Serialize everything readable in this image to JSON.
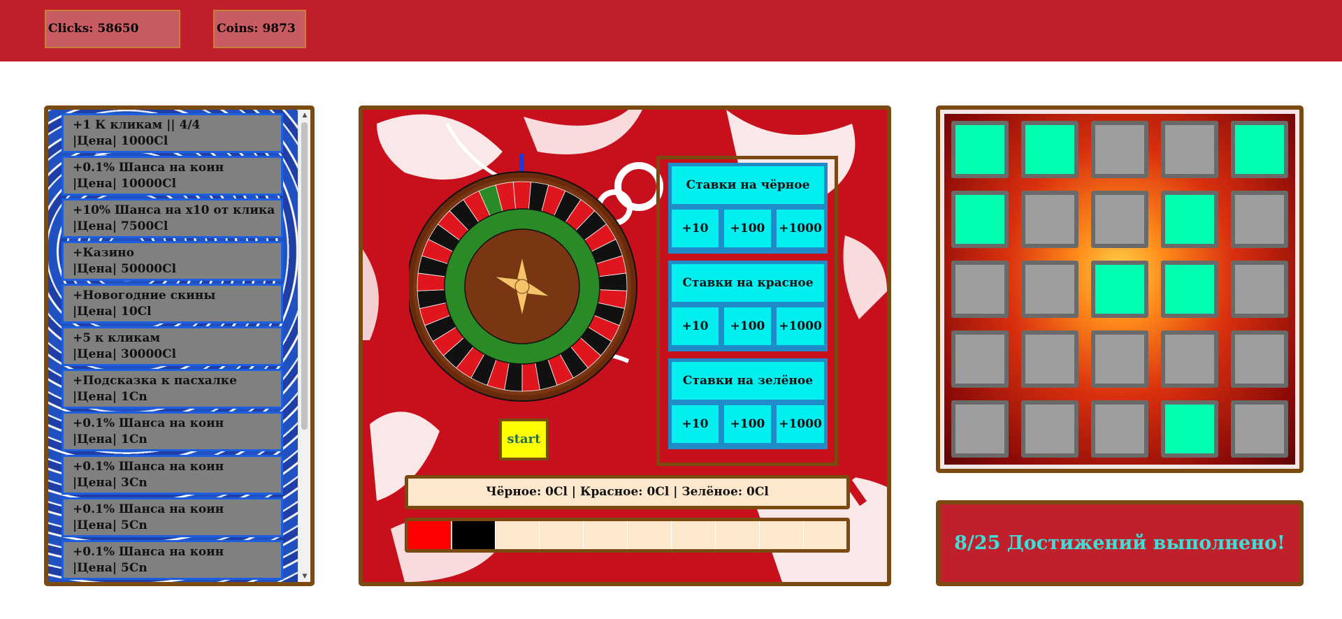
{
  "header": {
    "clicks_text": "Clicks: 58650",
    "coins_text": "Coins: 9873"
  },
  "shop": {
    "items": [
      {
        "line1": "+1 К кликам || 4/4",
        "line2": "|Цена| 1000Cl"
      },
      {
        "line1": "+0.1% Шанса на коин",
        "line2": "|Цена| 10000Cl"
      },
      {
        "line1": "+10% Шанса на x10 от клика",
        "line2": "|Цена| 7500Cl"
      },
      {
        "line1": "+Казино",
        "line2": "|Цена| 50000Cl"
      },
      {
        "line1": "+Новогодние скины",
        "line2": "|Цена| 10Cl"
      },
      {
        "line1": "+5 к кликам",
        "line2": "|Цена| 30000Cl"
      },
      {
        "line1": "+Подсказка к пасхалке",
        "line2": "|Цена| 1Cn"
      },
      {
        "line1": "+0.1% Шанса на коин",
        "line2": "|Цена| 1Cn"
      },
      {
        "line1": "+0.1% Шанса на коин",
        "line2": "|Цена| 3Cn"
      },
      {
        "line1": "+0.1% Шанса на коин",
        "line2": "|Цена| 5Cn"
      },
      {
        "line1": "+0.1% Шанса на коин",
        "line2": "|Цена| 5Cn"
      }
    ]
  },
  "casino": {
    "bet_groups": [
      {
        "title": "Ставки на чёрное",
        "buttons": [
          "+10",
          "+100",
          "+1000"
        ]
      },
      {
        "title": "Ставки на красное",
        "buttons": [
          "+10",
          "+100",
          "+1000"
        ]
      },
      {
        "title": "Ставки на зелёное",
        "buttons": [
          "+10",
          "+100",
          "+1000"
        ]
      }
    ],
    "start_label": "start",
    "summary": "Чёрное: 0Cl | Красное: 0Cl | Зелёное: 0Cl",
    "history": [
      "red",
      "black",
      "empty",
      "empty",
      "empty",
      "empty",
      "empty",
      "empty",
      "empty",
      "empty"
    ]
  },
  "achievements": {
    "grid": [
      [
        true,
        true,
        false,
        false,
        true
      ],
      [
        true,
        false,
        false,
        true,
        false
      ],
      [
        false,
        false,
        true,
        true,
        false
      ],
      [
        false,
        false,
        false,
        false,
        false
      ],
      [
        false,
        false,
        false,
        true,
        false
      ]
    ],
    "banner": "8/25 Достижений выполнено!"
  },
  "colors": {
    "header": "#c0202c",
    "panel_border": "#7a4a10",
    "shop_item": "#808080",
    "shop_item_border": "#1e5fe0",
    "bet_button": "#00f0f0",
    "achievement_done": "#00ffb0",
    "achievement_todo": "#9e9e9e",
    "banner_text": "#3ce0d8"
  }
}
